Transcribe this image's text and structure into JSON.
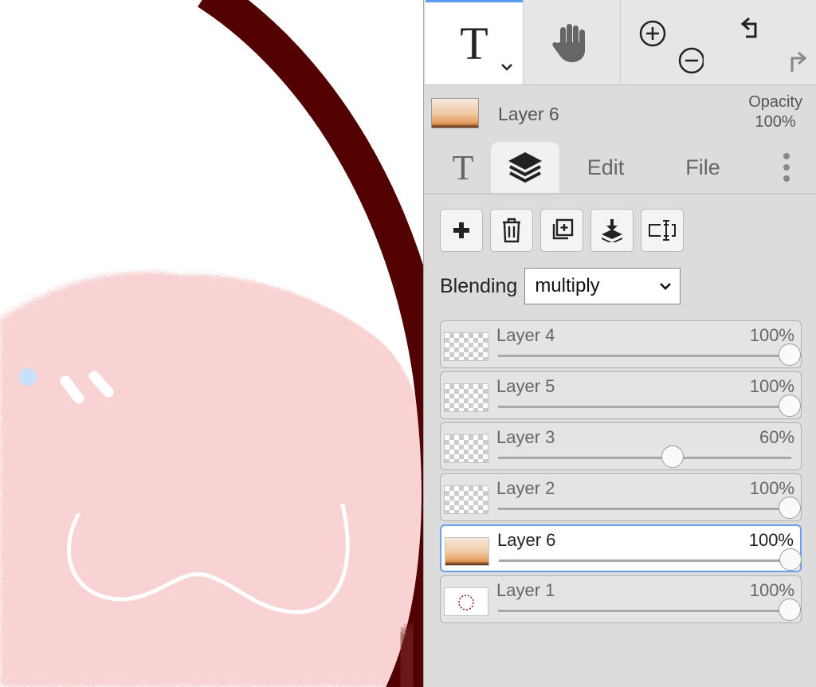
{
  "colors": {
    "canvas_bg": "#ffffff",
    "ring": "#520000",
    "pink": "#f9d3d3",
    "mark_white": "#ffffff",
    "mark_blue": "#c8e0fb",
    "panel_bg": "#dcdcdc",
    "accent": "#6a9ef0"
  },
  "toolbar": {
    "tools": [
      {
        "id": "text",
        "icon": "text-tool-icon",
        "glyph": "T",
        "active": true
      },
      {
        "id": "hand",
        "icon": "hand-icon"
      },
      {
        "id": "zoom",
        "icon": "zoom-in-out-icon"
      },
      {
        "id": "undo",
        "icon": "undo-redo-icon"
      }
    ]
  },
  "current_layer": {
    "name": "Layer 6",
    "opacity_label": "Opacity",
    "opacity_value": "100%"
  },
  "tabs": [
    {
      "id": "text",
      "glyph": "T",
      "icon": "text-icon"
    },
    {
      "id": "layers",
      "icon": "layers-icon",
      "active": true
    },
    {
      "id": "edit",
      "label": "Edit"
    },
    {
      "id": "file",
      "label": "File"
    },
    {
      "id": "more",
      "icon": "more-vertical-icon"
    }
  ],
  "layer_actions": [
    {
      "id": "add",
      "icon": "plus-icon"
    },
    {
      "id": "delete",
      "icon": "trash-icon"
    },
    {
      "id": "duplicate",
      "icon": "duplicate-icon"
    },
    {
      "id": "merge-down",
      "icon": "merge-down-icon"
    },
    {
      "id": "rename",
      "icon": "text-cursor-icon"
    }
  ],
  "blending": {
    "label": "Blending",
    "value": "multiply"
  },
  "layers": [
    {
      "name": "Layer 4",
      "opacity": "100%",
      "opacity_fraction": 1.0,
      "thumb": "checker",
      "active": false
    },
    {
      "name": "Layer 5",
      "opacity": "100%",
      "opacity_fraction": 1.0,
      "thumb": "checker",
      "active": false
    },
    {
      "name": "Layer 3",
      "opacity": "60%",
      "opacity_fraction": 0.6,
      "thumb": "checker",
      "active": false
    },
    {
      "name": "Layer 2",
      "opacity": "100%",
      "opacity_fraction": 1.0,
      "thumb": "checker",
      "active": false
    },
    {
      "name": "Layer 6",
      "opacity": "100%",
      "opacity_fraction": 1.0,
      "thumb": "orange",
      "active": true
    },
    {
      "name": "Layer 1",
      "opacity": "100%",
      "opacity_fraction": 1.0,
      "thumb": "ring",
      "active": false
    }
  ]
}
